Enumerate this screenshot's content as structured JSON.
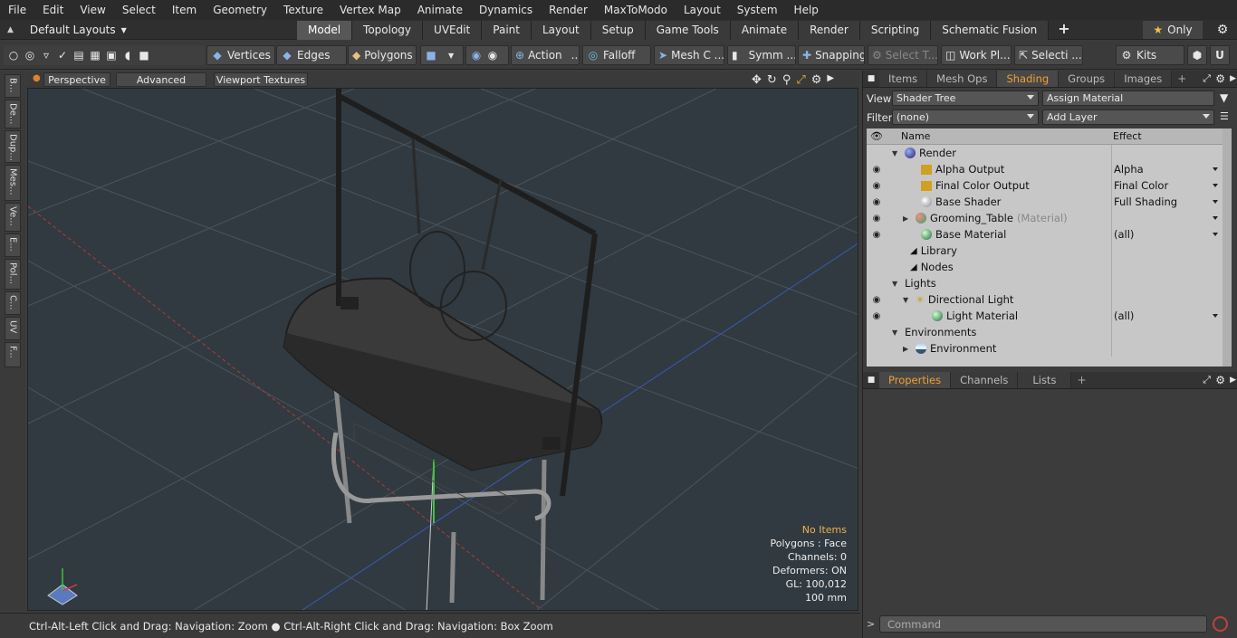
{
  "menu": [
    "File",
    "Edit",
    "View",
    "Select",
    "Item",
    "Geometry",
    "Texture",
    "Vertex Map",
    "Animate",
    "Dynamics",
    "Render",
    "MaxToModo",
    "Layout",
    "System",
    "Help"
  ],
  "layouts": {
    "label": "Default Layouts"
  },
  "mode_tabs": [
    "Model",
    "Topology",
    "UVEdit",
    "Paint",
    "Layout",
    "Setup",
    "Game Tools",
    "Animate",
    "Render",
    "Scripting",
    "Schematic Fusion"
  ],
  "only_label": "Only",
  "toolbar": {
    "vertices": "Vertices",
    "edges": "Edges",
    "polygons": "Polygons",
    "action": "Action",
    "falloff": "Falloff",
    "mesh": "Mesh C ...",
    "symm": "Symm ...",
    "snapping": "Snapping",
    "select_t": "Select T...",
    "work_plane": "Work Pl...",
    "selecti": "Selecti ...",
    "kits": "Kits"
  },
  "left_tabs": [
    "B...",
    "De...",
    "Dup...",
    "Mes...",
    "Ve...",
    "E...",
    "Pol...",
    "C...",
    "UV",
    "F..."
  ],
  "viewport": {
    "perspective": "Perspective",
    "advanced": "Advanced",
    "viewport_textures": "Viewport Textures",
    "info": {
      "no_items": "No Items",
      "polygons": "Polygons : Face",
      "channels": "Channels: 0",
      "deformers": "Deformers: ON",
      "gl": "GL: 100,012",
      "unit": "100 mm"
    }
  },
  "status": "Ctrl-Alt-Left Click and Drag: Navigation: Zoom ● Ctrl-Alt-Right Click and Drag: Navigation: Box Zoom",
  "right_panel": {
    "tabs": [
      "Items",
      "Mesh Ops",
      "Shading",
      "Groups",
      "Images"
    ],
    "active_tab": "Shading",
    "view_label": "View",
    "view_value": "Shader Tree",
    "assign_material": "Assign Material",
    "filter_label": "Filter",
    "filter_value": "(none)",
    "add_layer": "Add Layer",
    "col_name": "Name",
    "col_effect": "Effect",
    "rows": [
      {
        "name": "Render",
        "effect": ""
      },
      {
        "name": "Alpha Output",
        "effect": "Alpha"
      },
      {
        "name": "Final Color Output",
        "effect": "Final Color"
      },
      {
        "name": "Base Shader",
        "effect": "Full Shading"
      },
      {
        "name": "Grooming_Table",
        "suffix": "(Material)",
        "effect": ""
      },
      {
        "name": "Base Material",
        "effect": "(all)"
      },
      {
        "name": "Library",
        "effect": ""
      },
      {
        "name": "Nodes",
        "effect": ""
      },
      {
        "name": "Lights",
        "effect": ""
      },
      {
        "name": "Directional Light",
        "effect": ""
      },
      {
        "name": "Light Material",
        "effect": "(all)"
      },
      {
        "name": "Environments",
        "effect": ""
      },
      {
        "name": "Environment",
        "effect": ""
      }
    ],
    "bottom_tabs": [
      "Properties",
      "Channels",
      "Lists"
    ],
    "command_placeholder": "Command"
  }
}
